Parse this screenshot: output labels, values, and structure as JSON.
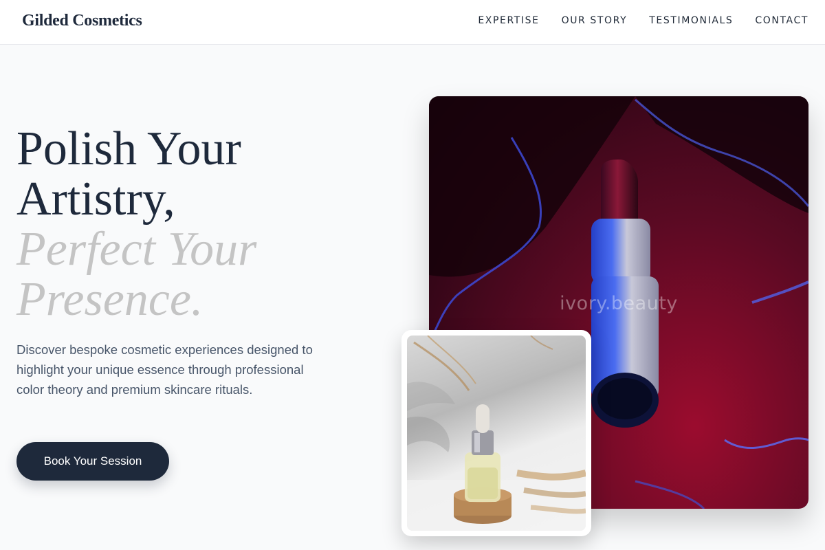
{
  "header": {
    "brand": "Gilded Cosmetics",
    "nav": [
      "EXPERTISE",
      "OUR STORY",
      "TESTIMONIALS",
      "CONTACT"
    ]
  },
  "hero": {
    "title_lines": [
      "Polish Your",
      "Artistry,"
    ],
    "accent_lines": [
      "Perfect Your",
      "Presence."
    ],
    "description": "Discover bespoke cosmetic experiences designed to highlight your unique essence through professional color theory and premium skincare rituals.",
    "cta_label": "Book Your Session"
  },
  "main_image": {
    "watermark": "ivory.beauty",
    "subject": "lipstick-on-red-liquid"
  },
  "secondary_image": {
    "subject": "serum-dropper-bottle-on-cork"
  },
  "colors": {
    "primary": "#1e293b",
    "accent_text": "#c4c4c4",
    "body_text": "#475569",
    "background": "#f9fafb",
    "lipstick_red": "#9b0c2e"
  }
}
